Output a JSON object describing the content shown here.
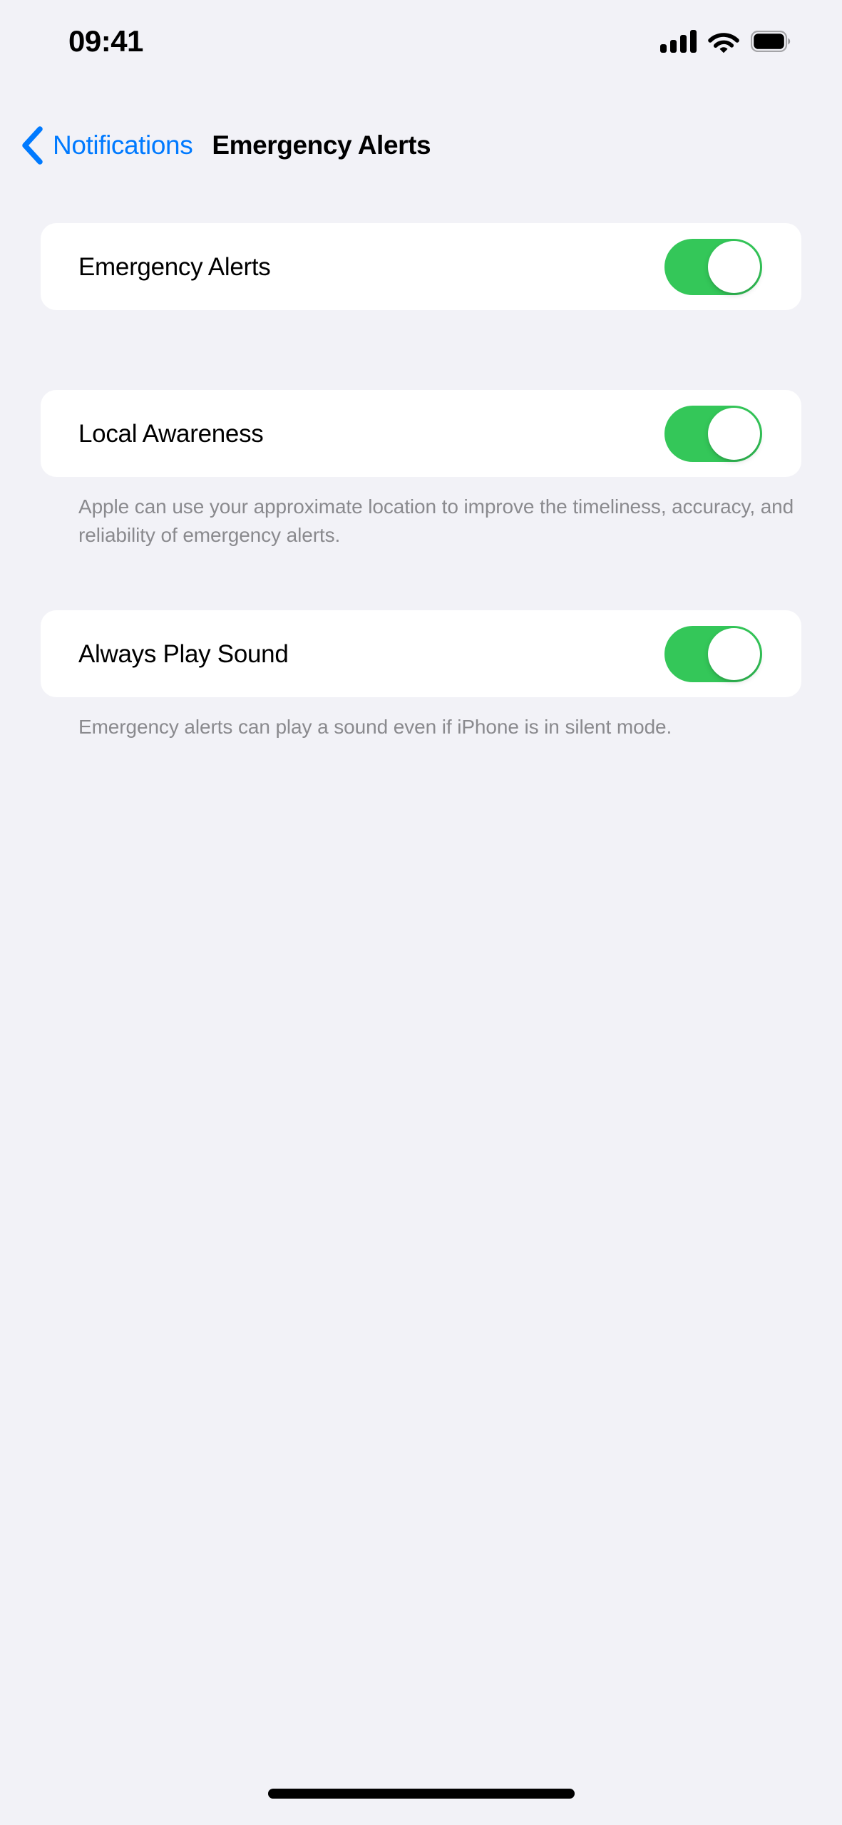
{
  "status_bar": {
    "time": "09:41",
    "cellular_icon": "cellular-signal-icon",
    "cellular_bars_filled": 4,
    "wifi_icon": "wifi-icon",
    "battery_icon": "battery-full-icon",
    "battery_level": 100
  },
  "nav": {
    "back_icon": "chevron-left-icon",
    "back_label": "Notifications",
    "title": "Emergency Alerts"
  },
  "groups": [
    {
      "rows": [
        {
          "label": "Emergency Alerts",
          "toggle": "on"
        }
      ],
      "footer": ""
    },
    {
      "rows": [
        {
          "label": "Local Awareness",
          "toggle": "on"
        }
      ],
      "footer": "Apple can use your approximate location to improve the timeliness, accuracy, and reliability of emergency alerts."
    },
    {
      "rows": [
        {
          "label": "Always Play Sound",
          "toggle": "on"
        }
      ],
      "footer": "Emergency alerts can play a sound even if iPhone is in silent mode."
    }
  ],
  "colors": {
    "accent_blue": "#007AFF",
    "toggle_on_green": "#34C759",
    "page_background": "#F2F2F7",
    "card_background": "#FFFFFF",
    "footer_text": "#8A8A8E"
  },
  "home_indicator": "home-indicator"
}
